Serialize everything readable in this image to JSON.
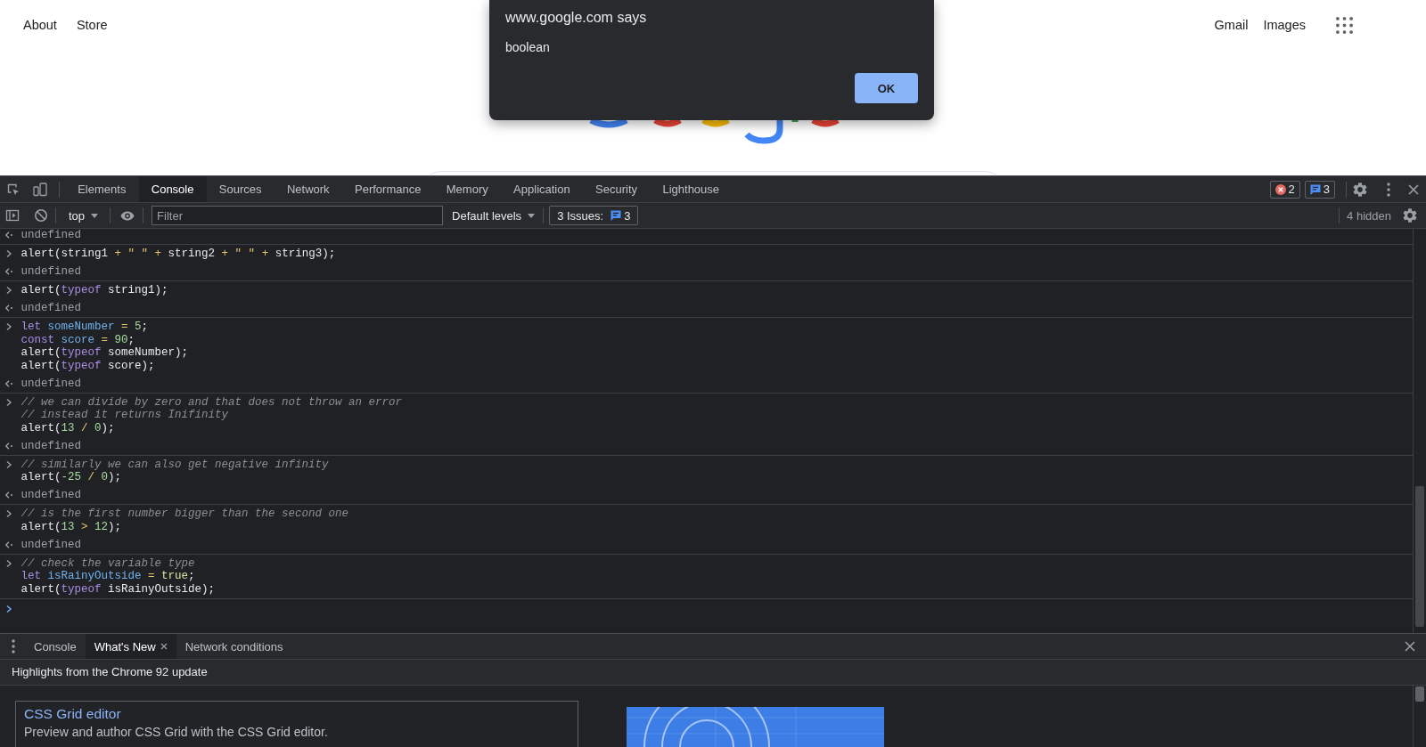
{
  "page": {
    "nav_left": [
      "About",
      "Store"
    ],
    "nav_right": [
      "Gmail",
      "Images"
    ]
  },
  "dialog": {
    "title": "www.google.com says",
    "message": "boolean",
    "button": "OK"
  },
  "devtools": {
    "tabs": [
      {
        "label": "Elements",
        "selected": false
      },
      {
        "label": "Console",
        "selected": true
      },
      {
        "label": "Sources",
        "selected": false
      },
      {
        "label": "Network",
        "selected": false
      },
      {
        "label": "Performance",
        "selected": false
      },
      {
        "label": "Memory",
        "selected": false
      },
      {
        "label": "Application",
        "selected": false
      },
      {
        "label": "Security",
        "selected": false
      },
      {
        "label": "Lighthouse",
        "selected": false
      }
    ],
    "badges": [
      {
        "kind": "error",
        "count": "2"
      },
      {
        "kind": "message",
        "count": "3"
      }
    ],
    "console_toolbar": {
      "context": "top",
      "filter": {
        "placeholder": "Filter"
      },
      "levels": "Default levels",
      "issues": {
        "label": "3 Issues:",
        "count": "3"
      },
      "hidden": "4 hidden"
    },
    "messages": [
      {
        "kind": "output",
        "text": "undefined"
      },
      {
        "kind": "input",
        "lines": [
          [
            {
              "text": "alert(string1 ",
              "kind": "plain"
            },
            {
              "text": "+",
              "kind": "operator"
            },
            {
              "text": " \" \" ",
              "kind": "string"
            },
            {
              "text": "+",
              "kind": "operator"
            },
            {
              "text": " string2 ",
              "kind": "plain"
            },
            {
              "text": "+",
              "kind": "operator"
            },
            {
              "text": " \" \" ",
              "kind": "string"
            },
            {
              "text": "+",
              "kind": "operator"
            },
            {
              "text": " string3);",
              "kind": "plain"
            }
          ]
        ]
      },
      {
        "kind": "output",
        "text": "undefined"
      },
      {
        "kind": "input",
        "lines": [
          [
            {
              "text": "alert(",
              "kind": "plain"
            },
            {
              "text": "typeof",
              "kind": "keyword"
            },
            {
              "text": " string1);",
              "kind": "plain"
            }
          ]
        ]
      },
      {
        "kind": "output",
        "text": "undefined"
      },
      {
        "kind": "input",
        "lines": [
          [
            {
              "text": "let ",
              "kind": "keyword"
            },
            {
              "text": "someNumber ",
              "kind": "variable"
            },
            {
              "text": "= ",
              "kind": "operator"
            },
            {
              "text": "5",
              "kind": "number"
            },
            {
              "text": ";",
              "kind": "plain"
            }
          ],
          [
            {
              "text": "const ",
              "kind": "keyword"
            },
            {
              "text": "score ",
              "kind": "variable"
            },
            {
              "text": "= ",
              "kind": "operator"
            },
            {
              "text": "90",
              "kind": "number"
            },
            {
              "text": ";",
              "kind": "plain"
            }
          ],
          [
            {
              "text": "alert(",
              "kind": "plain"
            },
            {
              "text": "typeof",
              "kind": "keyword"
            },
            {
              "text": " someNumber);",
              "kind": "plain"
            }
          ],
          [
            {
              "text": "alert(",
              "kind": "plain"
            },
            {
              "text": "typeof",
              "kind": "keyword"
            },
            {
              "text": " score);",
              "kind": "plain"
            }
          ]
        ]
      },
      {
        "kind": "output",
        "text": "undefined"
      },
      {
        "kind": "input",
        "lines": [
          [
            {
              "text": "// we can divide by zero and that does not throw an error",
              "kind": "comment"
            }
          ],
          [
            {
              "text": "// instead it returns Inifinity",
              "kind": "comment"
            }
          ],
          [
            {
              "text": "alert(",
              "kind": "plain"
            },
            {
              "text": "13 ",
              "kind": "number"
            },
            {
              "text": "/ ",
              "kind": "operator"
            },
            {
              "text": "0",
              "kind": "number"
            },
            {
              "text": ");",
              "kind": "plain"
            }
          ]
        ]
      },
      {
        "kind": "output",
        "text": "undefined"
      },
      {
        "kind": "input",
        "lines": [
          [
            {
              "text": "// similarly we can also get negative infinity",
              "kind": "comment"
            }
          ],
          [
            {
              "text": "alert(",
              "kind": "plain"
            },
            {
              "text": "-25 ",
              "kind": "number"
            },
            {
              "text": "/ ",
              "kind": "operator"
            },
            {
              "text": "0",
              "kind": "number"
            },
            {
              "text": ");",
              "kind": "plain"
            }
          ]
        ]
      },
      {
        "kind": "output",
        "text": "undefined"
      },
      {
        "kind": "input",
        "lines": [
          [
            {
              "text": "// is the first number bigger than the second one",
              "kind": "comment"
            }
          ],
          [
            {
              "text": "alert(",
              "kind": "plain"
            },
            {
              "text": "13 ",
              "kind": "number"
            },
            {
              "text": "> ",
              "kind": "operator"
            },
            {
              "text": "12",
              "kind": "number"
            },
            {
              "text": ");",
              "kind": "plain"
            }
          ]
        ]
      },
      {
        "kind": "output",
        "text": "undefined"
      },
      {
        "kind": "input",
        "lines": [
          [
            {
              "text": "// check the variable type",
              "kind": "comment"
            }
          ],
          [
            {
              "text": "let ",
              "kind": "keyword"
            },
            {
              "text": "isRainyOutside ",
              "kind": "variable"
            },
            {
              "text": "= ",
              "kind": "operator"
            },
            {
              "text": "true",
              "kind": "literal"
            },
            {
              "text": ";",
              "kind": "plain"
            }
          ],
          [
            {
              "text": "alert(",
              "kind": "plain"
            },
            {
              "text": "typeof",
              "kind": "keyword"
            },
            {
              "text": " isRainyOutside);",
              "kind": "plain"
            }
          ]
        ]
      }
    ],
    "drawer": {
      "tabs": [
        {
          "label": "Console",
          "selected": false,
          "closable": false
        },
        {
          "label": "What's New",
          "selected": true,
          "closable": true
        },
        {
          "label": "Network conditions",
          "selected": false,
          "closable": false
        }
      ],
      "heading": "Highlights from the Chrome 92 update",
      "cards": [
        {
          "title": "CSS Grid editor",
          "description": "Preview and author CSS Grid with the CSS Grid editor."
        }
      ]
    }
  }
}
